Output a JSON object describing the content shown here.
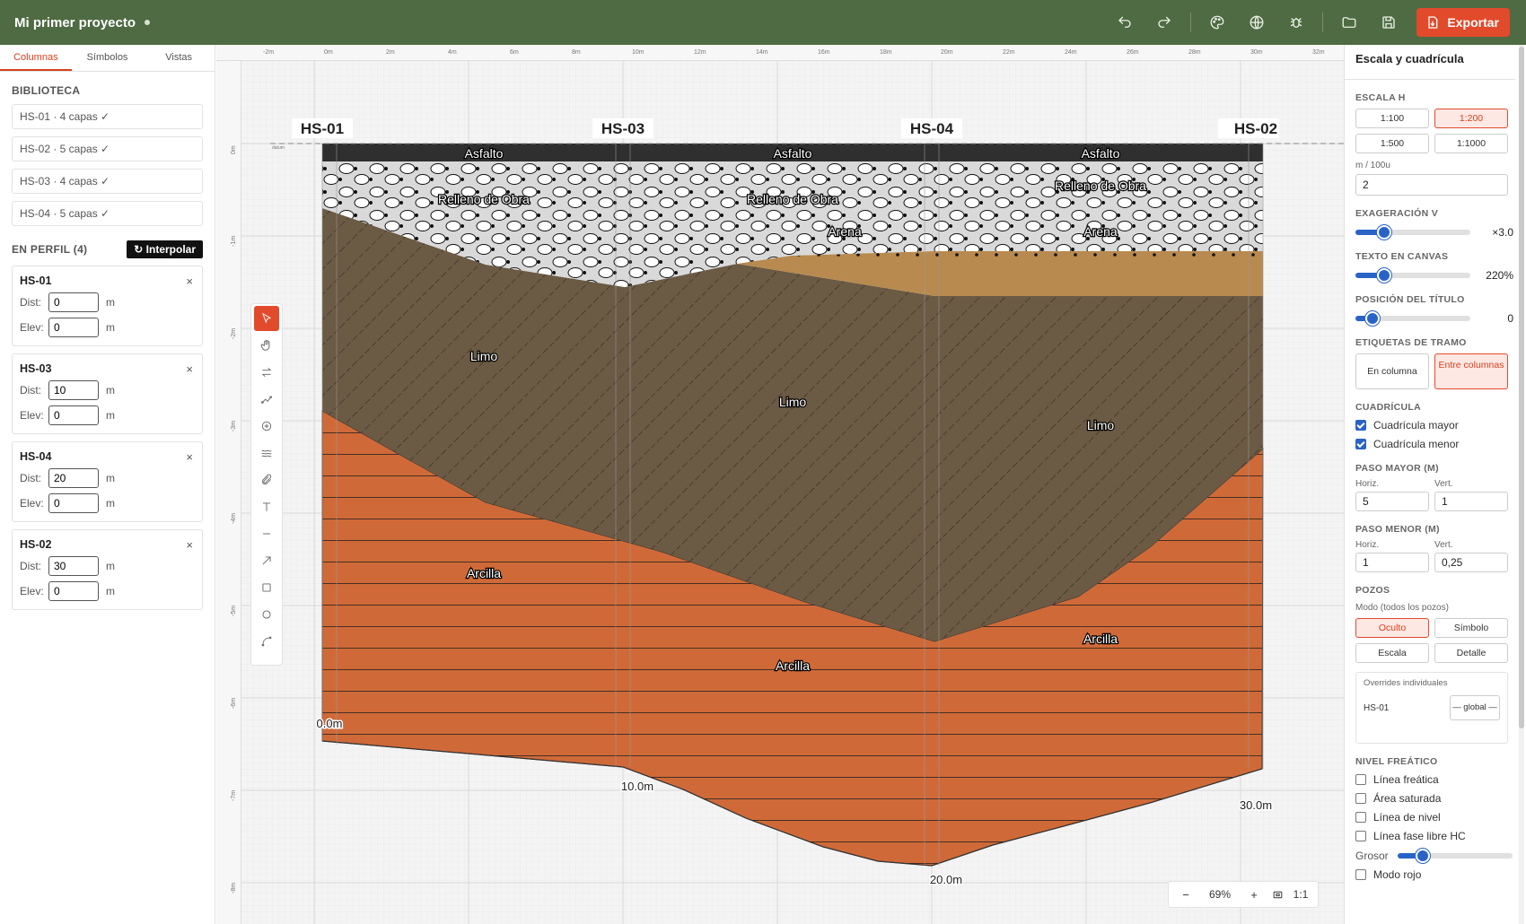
{
  "app": {
    "title": "Mi primer proyecto",
    "export_label": "Exportar",
    "toolbar_icons": [
      "undo-icon",
      "redo-icon",
      "palette-icon",
      "globe-icon",
      "bug-icon",
      "folder-icon",
      "save-icon"
    ]
  },
  "left": {
    "tabs": [
      "Columnas",
      "Símbolos",
      "Vistas"
    ],
    "active_tab": "Columnas",
    "library_title": "BIBLIOTECA",
    "library": [
      "HS-01 · 4 capas ✓",
      "HS-02 · 5 capas ✓",
      "HS-03 · 4 capas ✓",
      "HS-04 · 5 capas ✓"
    ],
    "profile_title": "EN PERFIL (4)",
    "interpolate_label": "↻ Interpolar",
    "dist_label": "Dist:",
    "elev_label": "Elev:",
    "unit": "m",
    "close": "×",
    "columns": [
      {
        "name": "HS-01",
        "dist": "0",
        "elev": "0"
      },
      {
        "name": "HS-03",
        "dist": "10",
        "elev": "0"
      },
      {
        "name": "HS-04",
        "dist": "20",
        "elev": "0"
      },
      {
        "name": "HS-02",
        "dist": "30",
        "elev": "0"
      }
    ]
  },
  "canvas": {
    "h_ruler": [
      "-2m",
      "0m",
      "2m",
      "4m",
      "6m",
      "8m",
      "10m",
      "12m",
      "14m",
      "16m",
      "18m",
      "20m",
      "22m",
      "24m",
      "26m",
      "28m",
      "30m",
      "32m"
    ],
    "v_ruler": [
      "0m",
      "-1m",
      "-2m",
      "-3m",
      "-4m",
      "-5m",
      "-6m",
      "-7m",
      "-8m"
    ],
    "datum_label": "datum",
    "column_titles": [
      "HS-01",
      "HS-03",
      "HS-04",
      "HS-02"
    ],
    "depth_labels": [
      "0.0m",
      "10.0m",
      "20.0m",
      "30.0m"
    ],
    "layers": {
      "asfalto": "Asfalto",
      "relleno": "Relleno de Obra",
      "arena": "Arena",
      "limo": "Limo",
      "arcilla": "Arcilla"
    },
    "colors": {
      "asfalto": "#2f2f2f",
      "relleno": "#d9d9d9",
      "arena": "#b88a4f",
      "limo": "#6b5a44",
      "arcilla": "#cf6a38"
    },
    "zoom": "69%",
    "zoom_minus": "−",
    "zoom_plus": "+",
    "zoom_one": "1:1"
  },
  "right": {
    "title": "Escala y cuadrícula",
    "escala_h_label": "ESCALA H",
    "escala_h_options": [
      "1:100",
      "1:200",
      "1:500",
      "1:1000"
    ],
    "escala_h_selected": "1:200",
    "m_per_100u_label": "m / 100u",
    "m_per_100u": "2",
    "exag_label": "EXAGERACIÓN V",
    "exag_value": "×3.0",
    "exag_level": 0.25,
    "texto_label": "TEXTO EN CANVAS",
    "texto_value": "220%",
    "texto_level": 0.25,
    "posicion_label": "POSICIÓN DEL TÍTULO",
    "posicion_value": "0",
    "posicion_level": 0.15,
    "etiquetas_label": "ETIQUETAS DE TRAMO",
    "etiquetas_options": [
      "En columna",
      "Entre columnas"
    ],
    "etiquetas_selected": "Entre columnas",
    "cuadricula_label": "CUADRÍCULA",
    "grid_major": "Cuadrícula mayor",
    "grid_minor": "Cuadrícula menor",
    "paso_mayor_label": "PASO MAYOR (M)",
    "paso_menor_label": "PASO MENOR (M)",
    "horiz_label": "Horiz.",
    "vert_label": "Vert.",
    "paso_mayor_h": "5",
    "paso_mayor_v": "1",
    "paso_menor_h": "1",
    "paso_menor_v": "0,25",
    "pozos_label": "POZOS",
    "pozos_mode_label": "Modo (todos los pozos)",
    "pozos_options": [
      "Oculto",
      "Símbolo",
      "Escala",
      "Detalle"
    ],
    "pozos_selected": "Oculto",
    "overrides_label": "Overrides individuales",
    "override_name": "HS-01",
    "override_value": "— global —",
    "nivel_label": "NIVEL FREÁTICO",
    "nivel_options": [
      "Línea freática",
      "Área saturada",
      "Línea de nivel",
      "Línea fase libre HC"
    ],
    "grosor_label": "Grosor",
    "grosor_level": 0.22,
    "modo_rojo": "Modo rojo"
  }
}
